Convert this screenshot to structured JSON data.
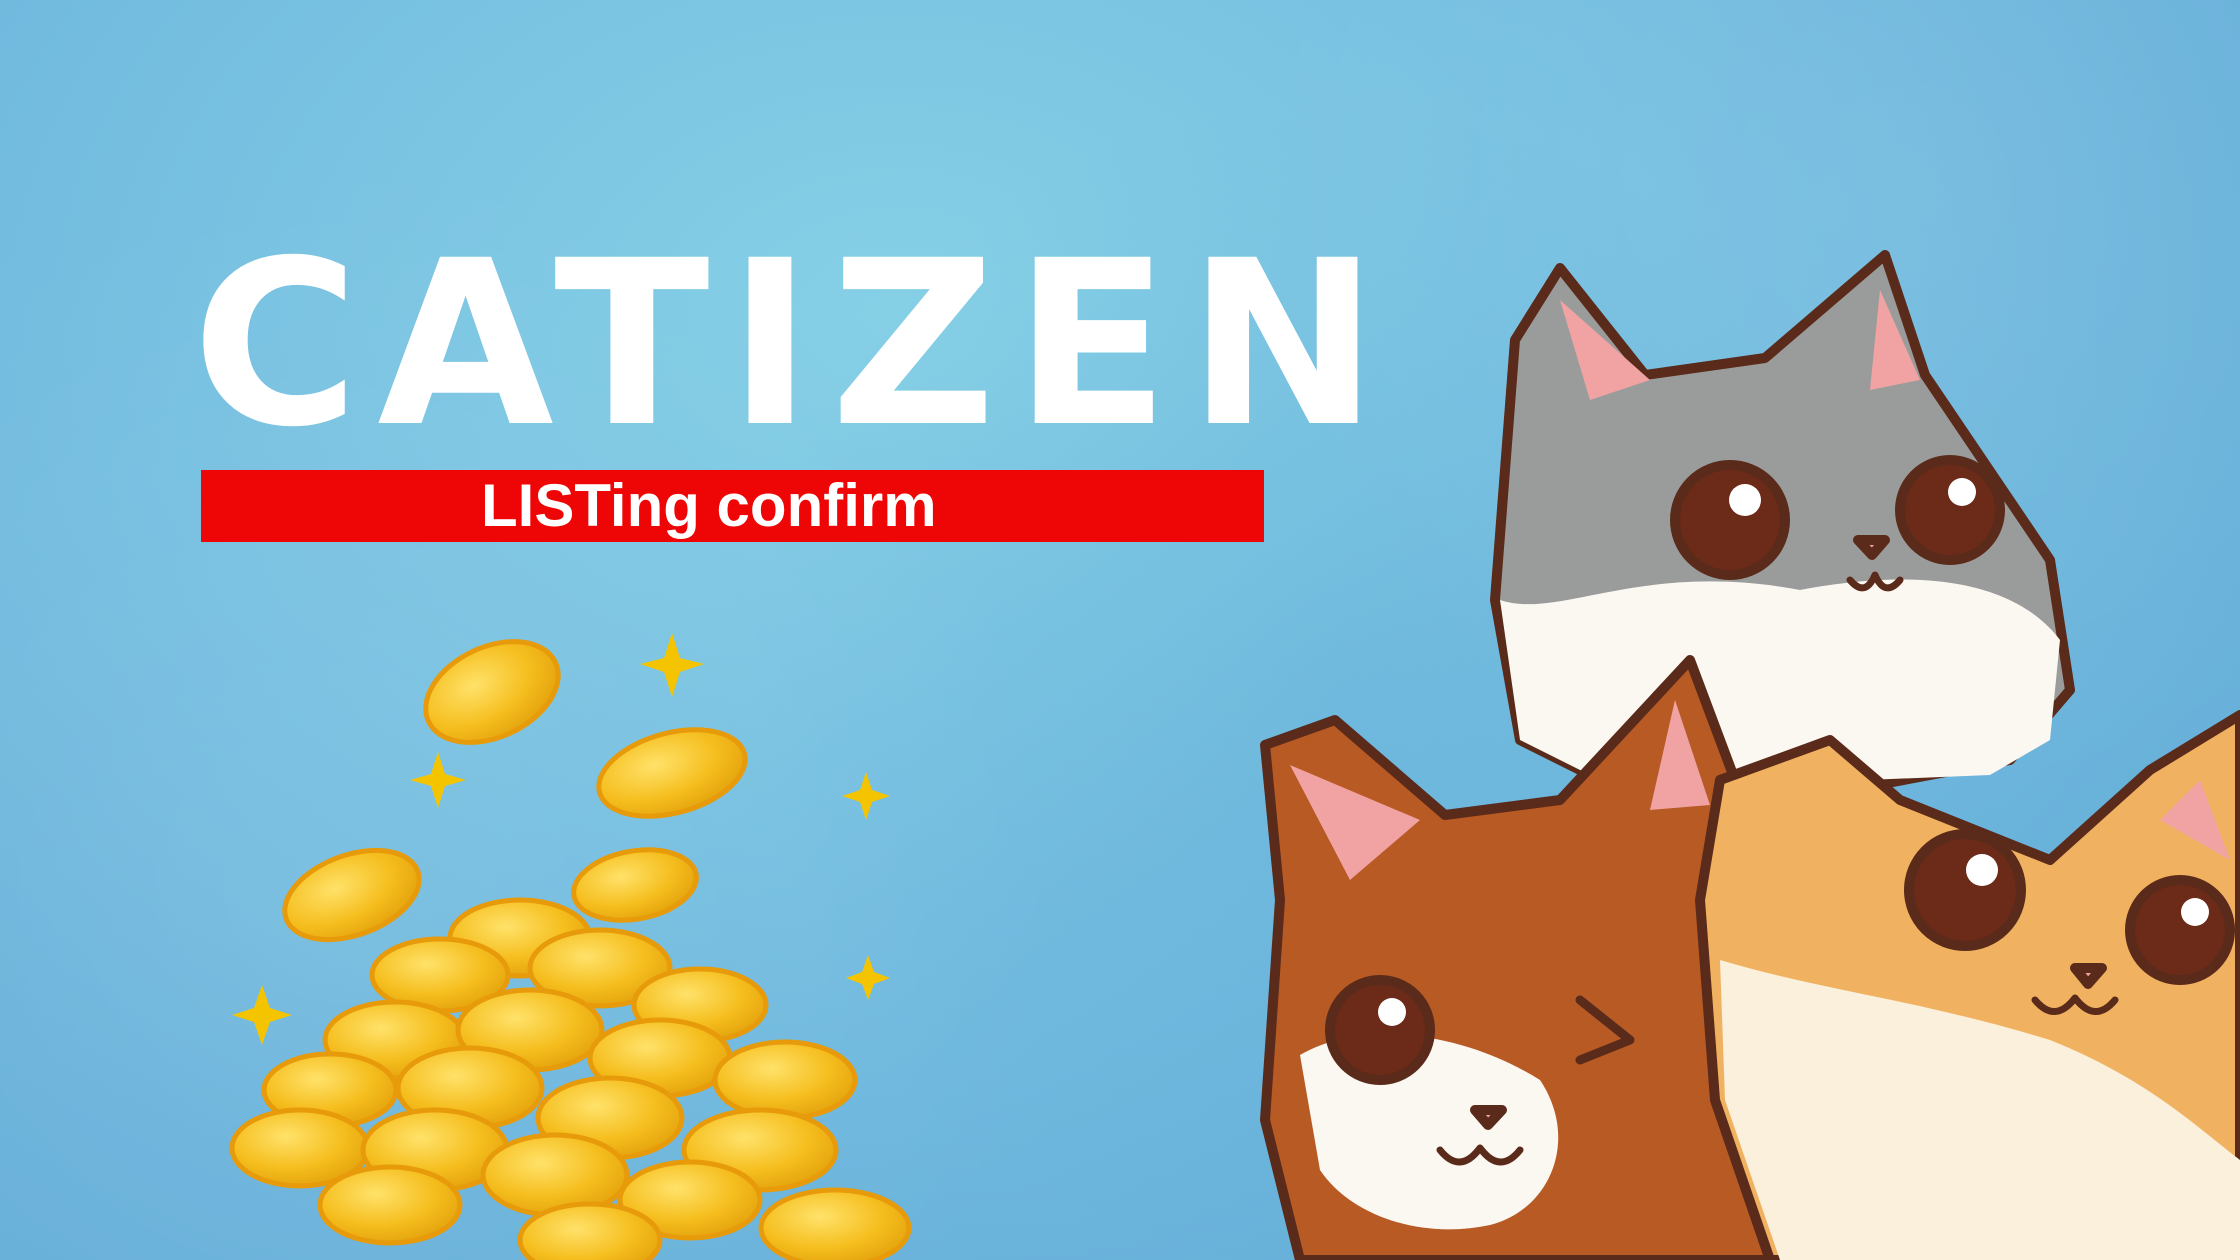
{
  "title": "CATIZEN",
  "banner": {
    "text": "LISTing confirm",
    "color": "#ee0505"
  },
  "colors": {
    "background": "#74bde0",
    "title": "#ffffff",
    "coin": "#f5be1e",
    "sparkle": "#f5c400",
    "gray_cat": "#9a9c9b",
    "brown_cat": "#b85a24",
    "orange_cat": "#f0b260"
  },
  "illustrations": [
    "coin-pile",
    "sparkle",
    "gray-tabby-cat",
    "brown-tabby-cat",
    "orange-tabby-cat"
  ]
}
